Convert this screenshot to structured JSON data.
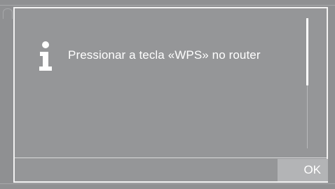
{
  "dialog": {
    "icon": "info-icon",
    "message": "Pressionar a tecla «WPS» no router",
    "ok_label": "OK"
  },
  "colors": {
    "background": "#8f9092",
    "dialog": "#959698",
    "border": "#f2f2f2",
    "button": "#b3b4b6",
    "text": "#ffffff"
  }
}
